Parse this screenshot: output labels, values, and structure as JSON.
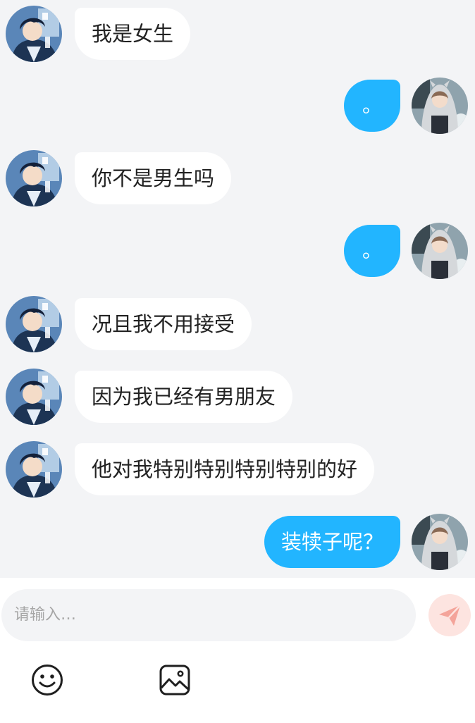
{
  "messages": [
    {
      "side": "left",
      "text": "我是女生",
      "avatar": "boy-avatar-icon"
    },
    {
      "side": "right",
      "text": "。",
      "avatar": "hooded-girl-avatar-icon"
    },
    {
      "side": "left",
      "text": "你不是男生吗",
      "avatar": "boy-avatar-icon"
    },
    {
      "side": "right",
      "text": "。",
      "avatar": "hooded-girl-avatar-icon"
    },
    {
      "side": "left",
      "text": "况且我不用接受",
      "avatar": "boy-avatar-icon"
    },
    {
      "side": "left",
      "text": "因为我已经有男朋友",
      "avatar": "boy-avatar-icon"
    },
    {
      "side": "left",
      "text": "他对我特别特别特别特别的好",
      "avatar": "boy-avatar-icon"
    },
    {
      "side": "right",
      "text": "装犊子呢？",
      "avatar": "hooded-girl-avatar-icon"
    }
  ],
  "input": {
    "placeholder": "请输入…"
  },
  "icons": {
    "send": "send-paper-plane-icon",
    "emoji": "smiley-face-icon",
    "image": "image-picture-icon"
  },
  "colors": {
    "chat_background": "#f3f4f6",
    "incoming_bubble": "#ffffff",
    "outgoing_bubble": "#22b5ff",
    "send_button_bg": "#fde4e0",
    "send_icon": "#f4a49a"
  }
}
